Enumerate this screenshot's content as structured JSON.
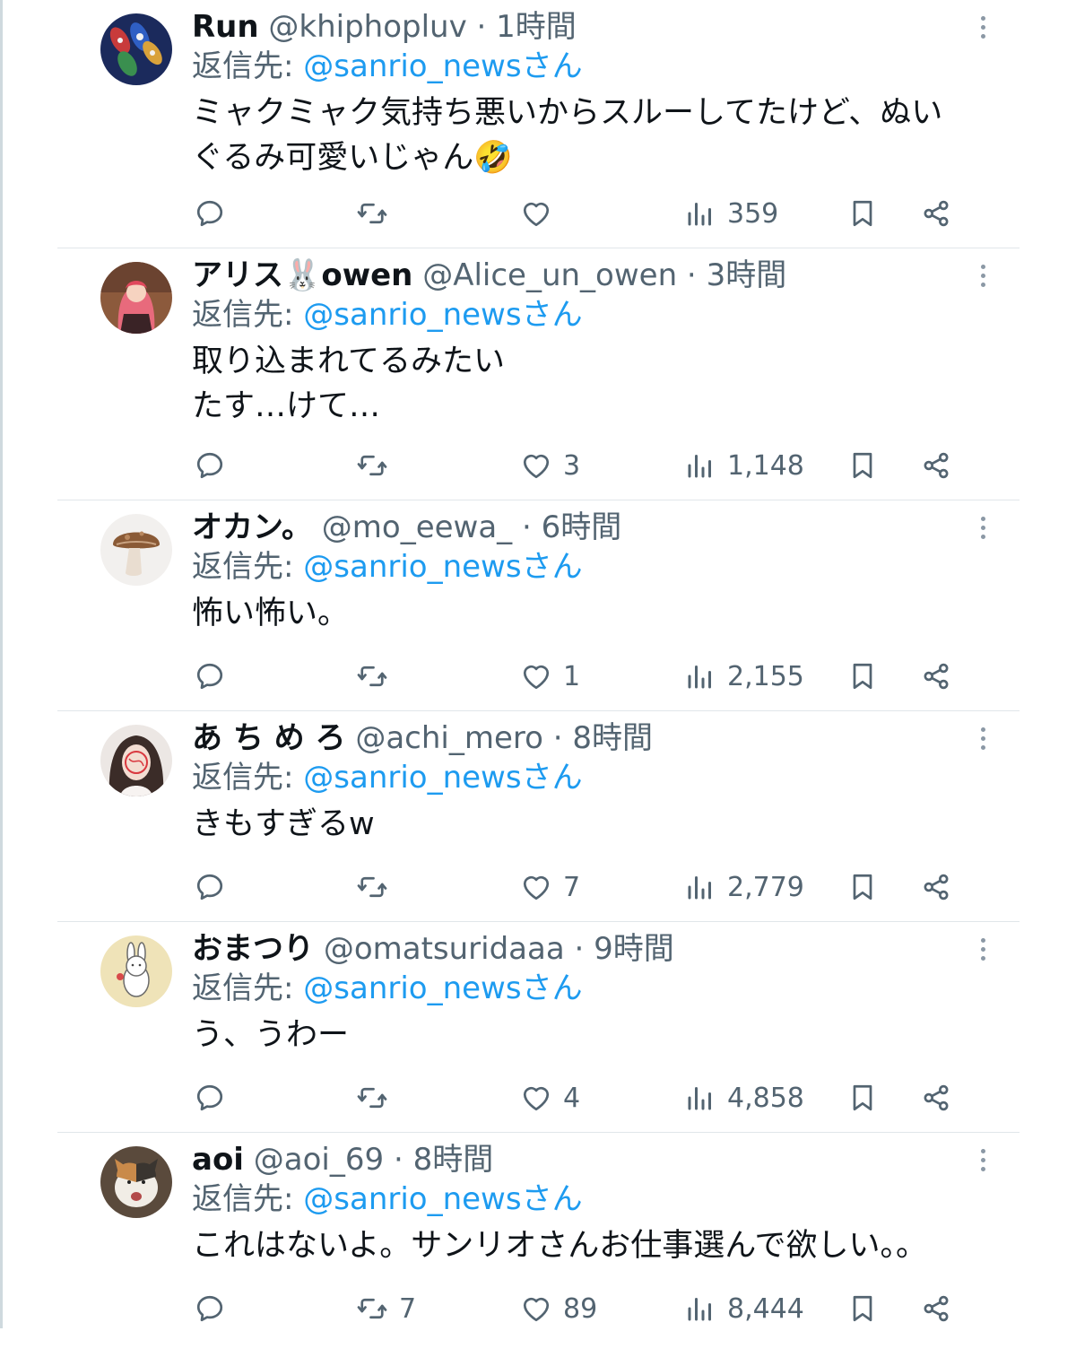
{
  "reply_prefix": "返信先: ",
  "tweets": [
    {
      "name": "Run",
      "handle": "@khiphopluv",
      "dot": " · ",
      "time": "1時間",
      "reply_to": "@sanrio_newsさん",
      "text": "ミャクミャク気持ち悪いからスルーしてたけど、ぬい\nぐるみ可愛いじゃん🤣",
      "replies": "",
      "retweets": "",
      "likes": "",
      "views": "359"
    },
    {
      "name": "アリス🐰owen",
      "handle": "@Alice_un_owen",
      "dot": " · ",
      "time": "3時間",
      "reply_to": "@sanrio_newsさん",
      "text": "取り込まれてるみたい\nたす…けて…",
      "replies": "",
      "retweets": "",
      "likes": "3",
      "views": "1,148"
    },
    {
      "name": "オカン。",
      "handle": "@mo_eewa_",
      "dot": " · ",
      "time": "6時間",
      "reply_to": "@sanrio_newsさん",
      "text": "怖い怖い。",
      "replies": "",
      "retweets": "",
      "likes": "1",
      "views": "2,155"
    },
    {
      "name": "あ ち め ろ",
      "handle": "@achi_mero",
      "dot": " · ",
      "time": "8時間",
      "reply_to": "@sanrio_newsさん",
      "text": "きもすぎるw",
      "replies": "",
      "retweets": "",
      "likes": "7",
      "views": "2,779"
    },
    {
      "name": "おまつり",
      "handle": "@omatsuridaaa",
      "dot": " · ",
      "time": "9時間",
      "reply_to": "@sanrio_newsさん",
      "text": "う、うわー",
      "replies": "",
      "retweets": "",
      "likes": "4",
      "views": "4,858"
    },
    {
      "name": "aoi",
      "handle": "@aoi_69",
      "dot": " · ",
      "time": "8時間",
      "reply_to": "@sanrio_newsさん",
      "text": "これはないよ。サンリオさんお仕事選んで欲しい。。",
      "replies": "",
      "retweets": "7",
      "likes": "89",
      "views": "8,444"
    }
  ],
  "icons": {
    "reply": "speech-bubble-icon",
    "retweet": "retweet-arrows-icon",
    "like": "heart-icon",
    "views": "bar-chart-icon",
    "bookmark": "bookmark-icon",
    "share": "share-icon",
    "more": "vertical-dots-icon"
  },
  "colors": {
    "text": "#0f1419",
    "secondary": "#536471",
    "link": "#1d9bf0",
    "divider": "#e1e6ea"
  }
}
